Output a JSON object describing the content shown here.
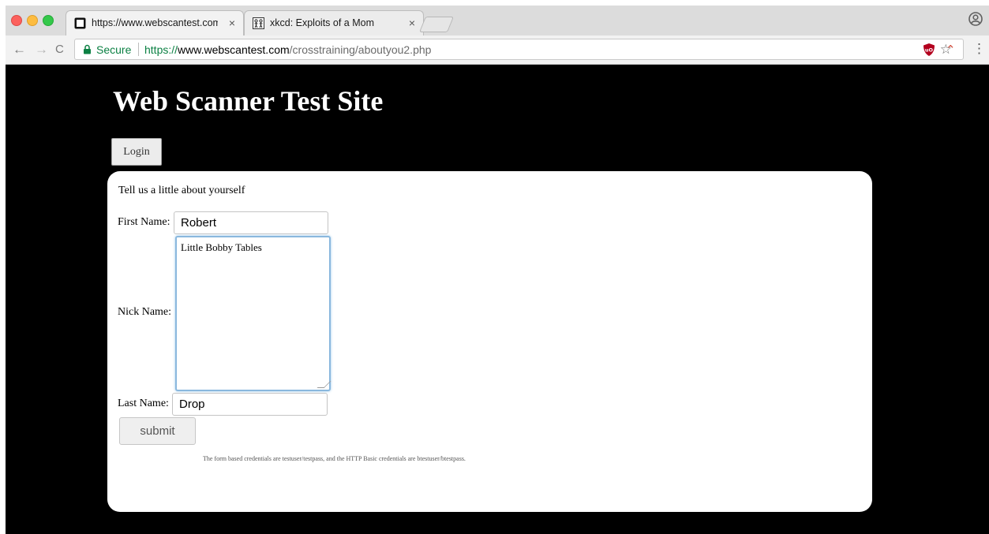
{
  "browser": {
    "tabs": [
      {
        "title": "https://www.webscantest.com/",
        "close": "×",
        "active": true
      },
      {
        "title": "xkcd: Exploits of a Mom",
        "close": "×",
        "active": false
      }
    ],
    "nav": {
      "back": "←",
      "forward": "→",
      "reload": "C"
    },
    "address": {
      "secure_label": "Secure",
      "scheme": "https://",
      "host": "www.webscantest.com",
      "path": "/crosstraining/aboutyou2.php"
    },
    "bookmark_star": "☆",
    "menu": "⋮",
    "extension_glyph": "⌃"
  },
  "page": {
    "site_title": "Web Scanner Test Site",
    "login_label": "Login",
    "form": {
      "intro": "Tell us a little about yourself",
      "first_name_label": "First Name:",
      "first_name_value": "Robert",
      "nick_name_label": "Nick Name:",
      "nick_name_value": "Little Bobby Tables",
      "last_name_label": "Last Name:",
      "last_name_value": "Drop",
      "submit_label": "submit"
    },
    "credentials_note": "The form based credentials are testuser/testpass, and the HTTP Basic credentials are btestuser/btestpass."
  },
  "colors": {
    "page_background": "#000000",
    "secure_green": "#0b8043",
    "focus_blue": "#8ab8de"
  }
}
